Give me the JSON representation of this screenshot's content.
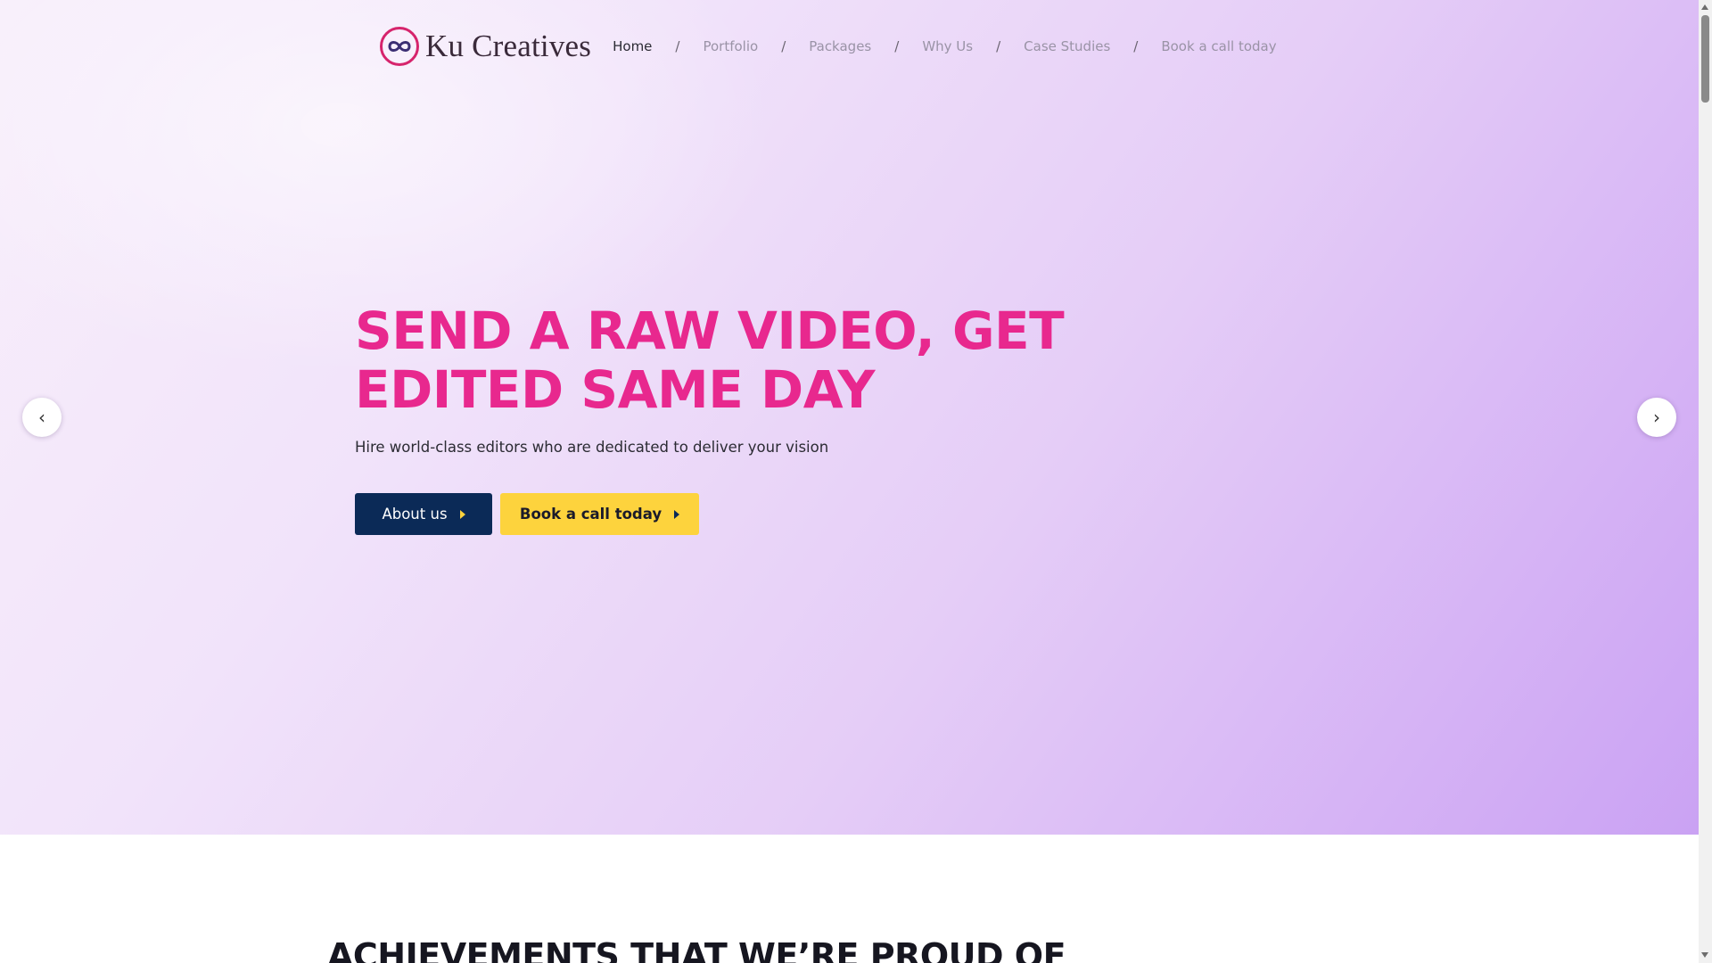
{
  "brand": {
    "name": "Ku Creatives",
    "logo_icon": "infinity-icon",
    "colors": {
      "logo_ring": "#d6246c",
      "logo_inner": "#3b2e73"
    }
  },
  "nav": {
    "items": [
      {
        "label": "Home",
        "active": true
      },
      {
        "label": "Portfolio",
        "active": false
      },
      {
        "label": "Packages",
        "active": false
      },
      {
        "label": "Why Us",
        "active": false
      },
      {
        "label": "Case Studies",
        "active": false
      },
      {
        "label": "Book a call today",
        "active": false
      }
    ],
    "separator": "/"
  },
  "hero": {
    "headline_line1": "SEND A RAW VIDEO, GET",
    "headline_line2": "EDITED SAME DAY",
    "subtext": "Hire world-class editors who are dedicated to deliver your vision",
    "primary_cta": "About us",
    "secondary_cta": "Book a call today",
    "prev_icon": "chevron-left-icon",
    "next_icon": "chevron-right-icon",
    "prev_glyph": "‹",
    "next_glyph": "›"
  },
  "achievements": {
    "title": "ACHIEVEMENTS THAT WE’RE PROUD OF"
  },
  "colors": {
    "headline": "#e8288e",
    "primary_button": "#0b2a57",
    "secondary_button": "#fdd33d",
    "hero_gradient_start": "#f8effb",
    "hero_gradient_end": "#caa2f3"
  }
}
